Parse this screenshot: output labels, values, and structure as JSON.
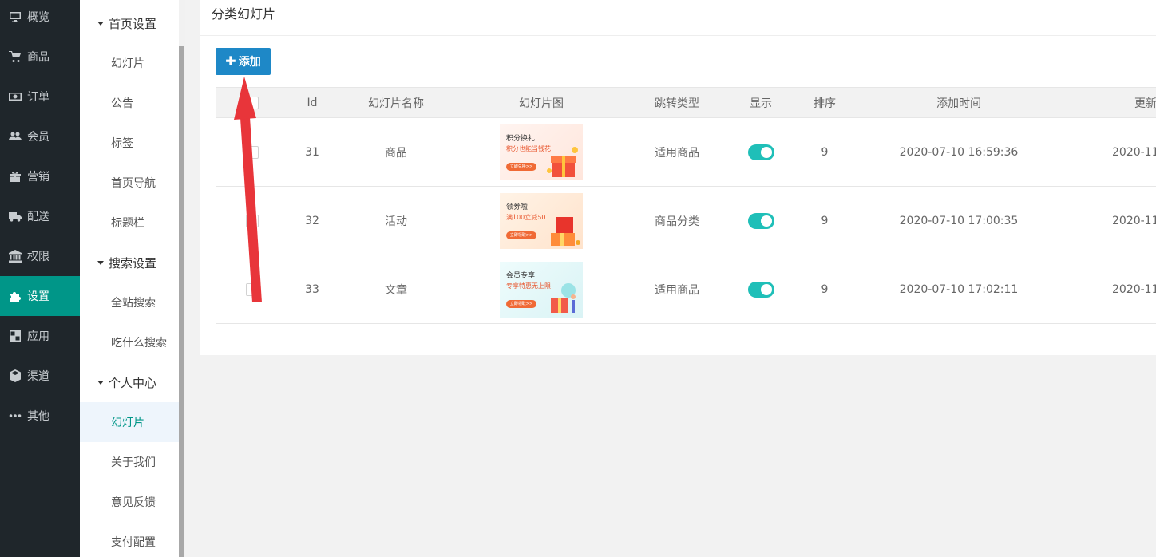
{
  "nav": [
    {
      "label": "概览",
      "icon": "monitor-icon"
    },
    {
      "label": "商品",
      "icon": "cart-icon"
    },
    {
      "label": "订单",
      "icon": "money-icon"
    },
    {
      "label": "会员",
      "icon": "users-icon"
    },
    {
      "label": "营销",
      "icon": "gift-icon"
    },
    {
      "label": "配送",
      "icon": "truck-icon"
    },
    {
      "label": "权限",
      "icon": "bank-icon"
    },
    {
      "label": "设置",
      "icon": "puzzle-icon"
    },
    {
      "label": "应用",
      "icon": "apps-icon"
    },
    {
      "label": "渠道",
      "icon": "cube-icon"
    },
    {
      "label": "其他",
      "icon": "more-icon"
    }
  ],
  "subnav": {
    "group_home": "首页设置",
    "home_items": [
      "幻灯片",
      "公告",
      "标签",
      "首页导航",
      "标题栏"
    ],
    "group_search": "搜索设置",
    "search_items": [
      "全站搜索",
      "吃什么搜索"
    ],
    "group_user": "个人中心",
    "user_items": [
      "幻灯片",
      "关于我们",
      "意见反馈",
      "支付配置"
    ]
  },
  "card": {
    "title": "分类幻灯片",
    "add_label": "添加"
  },
  "table": {
    "headers": [
      "Id",
      "幻灯片名称",
      "幻灯片图",
      "跳转类型",
      "显示",
      "排序",
      "添加时间",
      "更新"
    ],
    "rows": [
      {
        "id": "31",
        "name": "商品",
        "img_title": "积分换礼",
        "img_sub": "积分也能当钱花",
        "img_btn": "立即兑换>>",
        "type": "适用商品",
        "show": true,
        "sort": "9",
        "added": "2020-07-10 16:59:36",
        "updated": "2020-11-"
      },
      {
        "id": "32",
        "name": "活动",
        "img_title": "领券啦",
        "img_sub": "满100立减50",
        "img_btn": "立即领取>>",
        "type": "商品分类",
        "show": true,
        "sort": "9",
        "added": "2020-07-10 17:00:35",
        "updated": "2020-11-"
      },
      {
        "id": "33",
        "name": "文章",
        "img_title": "会员专享",
        "img_sub": "专享特惠无上限",
        "img_btn": "立即领取>>",
        "type": "适用商品",
        "show": true,
        "sort": "9",
        "added": "2020-07-10 17:02:11",
        "updated": "2020-11-"
      }
    ]
  },
  "colors": {
    "sidebar_bg": "#1f262b",
    "active_nav": "#009688",
    "add_button": "#1e88c7",
    "toggle_on": "#1fbfb8",
    "annotation_arrow": "#e8353a"
  }
}
